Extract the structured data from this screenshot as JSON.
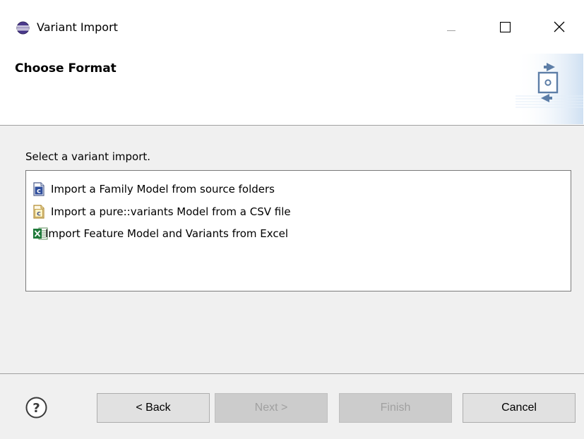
{
  "window": {
    "title": "Variant Import",
    "icon": "eclipse-icon",
    "controls": [
      "minimize-icon",
      "maximize-icon",
      "close-icon"
    ]
  },
  "header": {
    "title": "Choose Format",
    "banner_icon": "wizard-import-icon"
  },
  "body": {
    "prompt": "Select a variant import.",
    "items": [
      {
        "label": "Import a Family Model from source folders",
        "icon": "family-model-icon"
      },
      {
        "label": "Import a pure::variants Model from a CSV file",
        "icon": "csv-model-icon"
      },
      {
        "label": "Import Feature Model and Variants from Excel",
        "icon": "excel-icon"
      }
    ]
  },
  "footer": {
    "help_icon": "help-icon",
    "back_label": "< Back",
    "next_label": "Next >",
    "finish_label": "Finish",
    "cancel_label": "Cancel"
  },
  "colors": {
    "background": "#f0f0f0",
    "header_bg": "#ffffff",
    "button_bg": "#e1e1e1",
    "disabled_text": "#a0a0a0",
    "eclipse_purple": "#3b2a6e"
  }
}
